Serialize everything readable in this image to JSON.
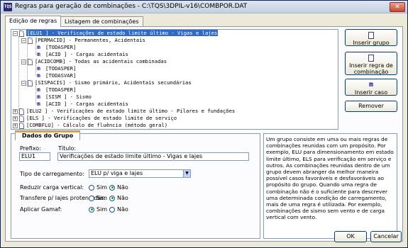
{
  "window": {
    "title": "Regras para geração de combinações - C:\\TQS\\3DPIL-v16\\COMBPOR.DAT",
    "app_icon_text": "TQS"
  },
  "tabs": [
    {
      "label": "Edição de regras",
      "active": true
    },
    {
      "label": "Listagem de combinações",
      "active": false
    }
  ],
  "tree": {
    "rows": [
      {
        "text": "[ELU1   ] - Verificações de estado limite último - Vigas e lajes",
        "level": 0,
        "expander": "-",
        "icon": "doc",
        "selected": true
      },
      {
        "text": "[PERMACID] - Permanentes, Acidentais",
        "level": 1,
        "expander": "-",
        "icon": "doc",
        "selected": false
      },
      {
        "text": "[TODASPER]",
        "level": 2,
        "expander": "",
        "icon": "m",
        "selected": false
      },
      {
        "text": "[ACID    ] - Cargas acidentais",
        "level": 2,
        "expander": "",
        "icon": "m",
        "selected": false
      },
      {
        "text": "[ACIDCOMB] - Todas as acidentais combinadas",
        "level": 1,
        "expander": "-",
        "icon": "doc",
        "selected": false
      },
      {
        "text": "[TODASPER]",
        "level": 2,
        "expander": "",
        "icon": "m",
        "selected": false
      },
      {
        "text": "[TODASVAR]",
        "level": 2,
        "expander": "",
        "icon": "m",
        "selected": false
      },
      {
        "text": "[SISPACIS] - Sismo primário, Acidentais secundárias",
        "level": 1,
        "expander": "-",
        "icon": "doc",
        "selected": false
      },
      {
        "text": "[TODASPER]",
        "level": 2,
        "expander": "",
        "icon": "m",
        "selected": false
      },
      {
        "text": "[SISM    ] - Sismo",
        "level": 2,
        "expander": "",
        "icon": "m",
        "selected": false
      },
      {
        "text": "[ACID    ] - Cargas acidentais",
        "level": 2,
        "expander": "",
        "icon": "m",
        "selected": false
      },
      {
        "text": "[ELU2   ] - Verificações de estado limite último - Pilares e fundações",
        "level": 0,
        "expander": "+",
        "icon": "doc",
        "selected": false
      },
      {
        "text": "[ELS    ] - Verificações de estado limite de serviço",
        "level": 0,
        "expander": "+",
        "icon": "doc",
        "selected": false
      },
      {
        "text": "[COMBFLU] - Cálculo de fluência (método geral)",
        "level": 0,
        "expander": "+",
        "icon": "doc",
        "selected": false
      }
    ]
  },
  "side_buttons": {
    "insert_group": "Inserir grupo",
    "insert_rule_line1": "Inserir regra de",
    "insert_rule_line2": "combinação",
    "insert_case": "Inserir caso",
    "remove": "Remover"
  },
  "group_panel": {
    "tab_label": "Dados do Grupo",
    "prefix_label": "Prefixo:",
    "prefix_value": "ELU1",
    "title_label": "Título:",
    "title_value": "Verificações de estado limite último - Vigas e lajes",
    "load_type_label": "Tipo de carregamento:",
    "load_type_value": "ELU p/ viga e lajes",
    "reduce_label": "Reduzir carga vertical:",
    "prestressed_label": "Transfere p/ lajes protendidas:",
    "gamaf_label": "Aplicar Gamaf:",
    "yes": "Sim",
    "no": "Não",
    "reduce_value": "Não",
    "prestressed_value": "Não",
    "gamaf_value": "Sim"
  },
  "help_text": "Um grupo consiste em uma ou mais regras de combinações reunidas com um propósito. Por exemplo, ELU para dimensionamento em estado limite último, ELS para verificação em serviço e outros. As combinações reunidas dentro de um grupo devem abranger da melhor maneira possível casos favoráveis e desfavoráveis ao propósito do grupo. Quando uma regra de combinação não é o suficiente para descrever uma determinada condição de carregamento, mais de uma regra é utilizada. Por exemplo, combinações de sismo sem vento e de carga vertical com vento.",
  "footer": {
    "ok": "OK",
    "cancel": "Cancelar"
  }
}
